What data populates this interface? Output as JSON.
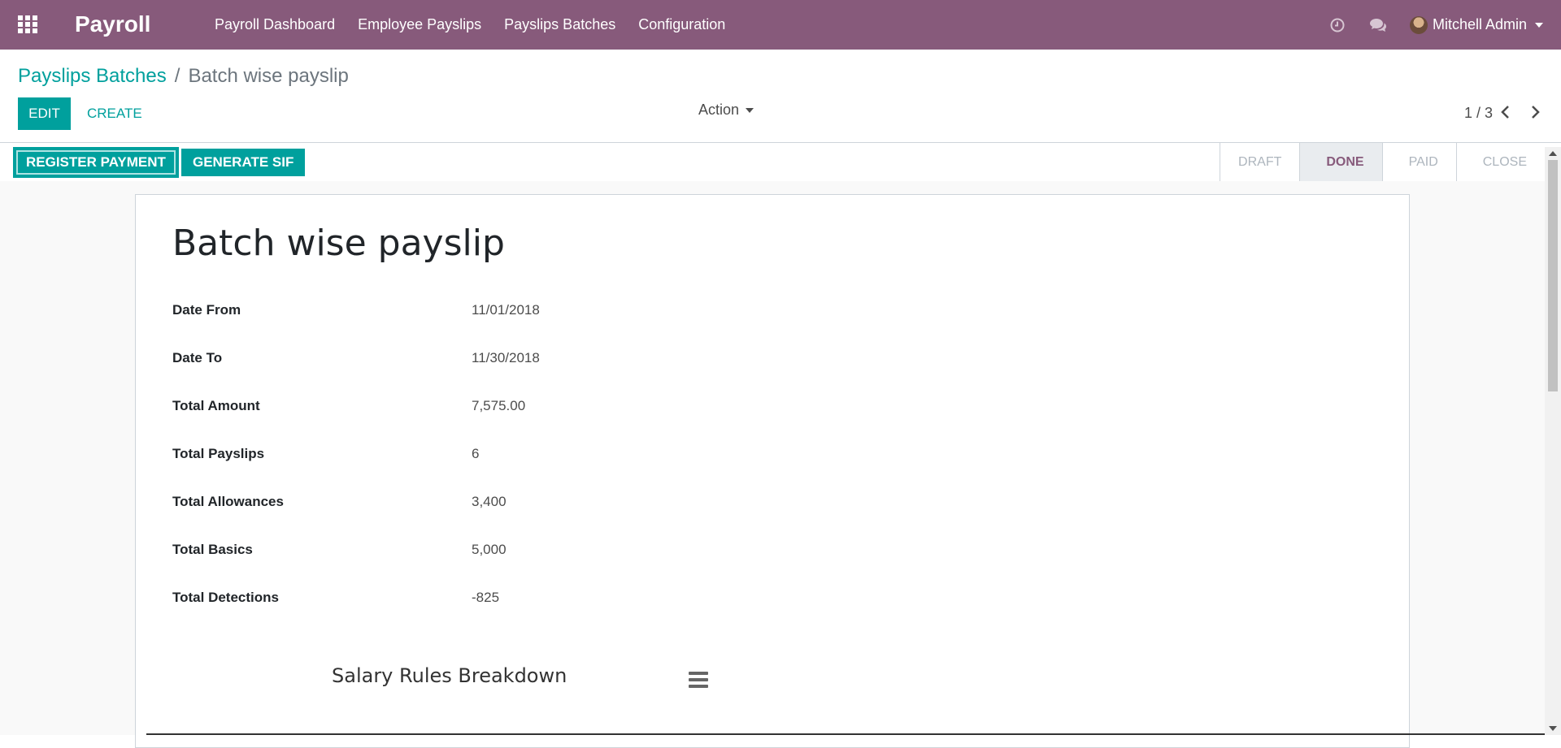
{
  "navbar": {
    "app_name": "Payroll",
    "menu": [
      "Payroll Dashboard",
      "Employee Payslips",
      "Payslips Batches",
      "Configuration"
    ],
    "user_name": "Mitchell Admin",
    "icons": [
      "apps-icon",
      "clock-icon",
      "chat-icon"
    ]
  },
  "breadcrumb": {
    "parent": "Payslips Batches",
    "separator": "/",
    "current": "Batch wise payslip"
  },
  "toolbar": {
    "edit_label": "EDIT",
    "create_label": "CREATE",
    "action_label": "Action",
    "pager": "1 / 3"
  },
  "statusbar": {
    "register_payment_label": "REGISTER PAYMENT",
    "generate_sif_label": "GENERATE SIF",
    "stages": [
      "DRAFT",
      "DONE",
      "PAID",
      "CLOSE"
    ],
    "active_stage": "DONE"
  },
  "form": {
    "title": "Batch wise payslip",
    "fields": [
      {
        "label": "Date From",
        "value": "11/01/2018"
      },
      {
        "label": "Date To",
        "value": "11/30/2018"
      },
      {
        "label": "Total Amount",
        "value": "7,575.00"
      },
      {
        "label": "Total Payslips",
        "value": "6"
      },
      {
        "label": "Total Allowances",
        "value": "3,400"
      },
      {
        "label": "Total Basics",
        "value": "5,000"
      },
      {
        "label": "Total Detections",
        "value": "-825"
      }
    ],
    "chart_title": "Salary Rules Breakdown"
  },
  "colors": {
    "brand": "#875a7b",
    "accent": "#00a09d"
  }
}
